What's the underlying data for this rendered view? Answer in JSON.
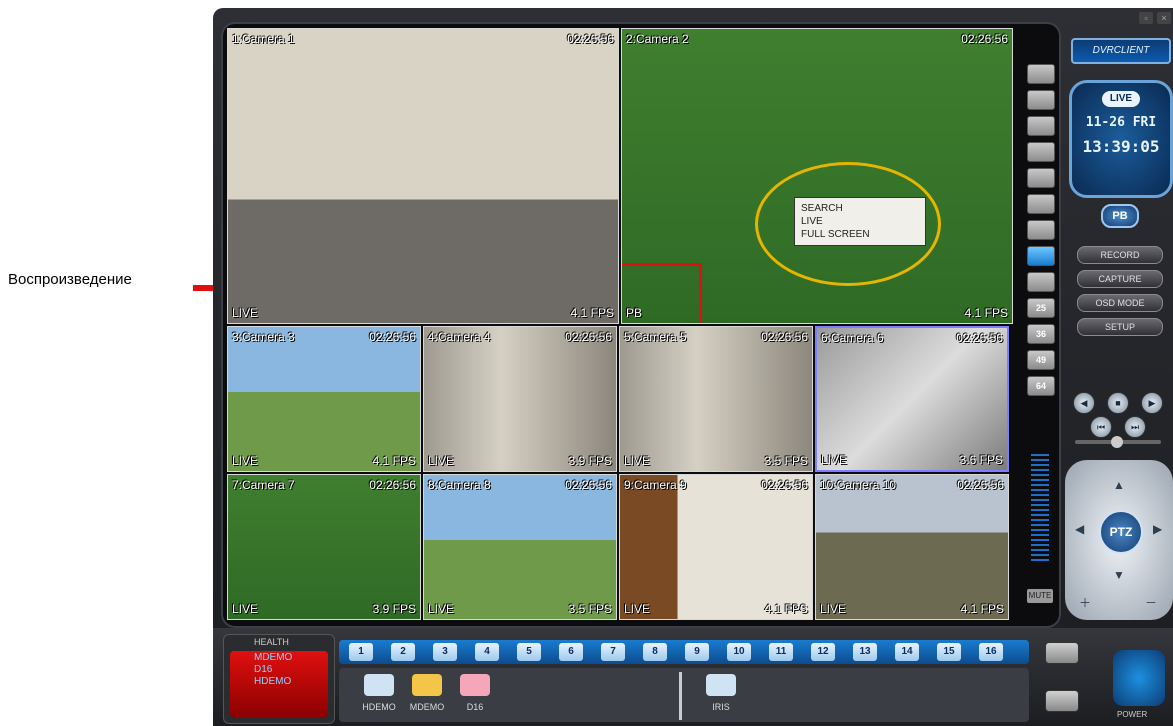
{
  "annotation": {
    "label": "Воспроизведение",
    "arrow_color": "#e01010"
  },
  "app": {
    "title": "DVRCLIENT",
    "status": "LIVE",
    "date": "11-26 FRI",
    "time": "13:39:05",
    "pb_label": "PB",
    "buttons": [
      "RECORD",
      "CAPTURE",
      "OSD MODE",
      "SETUP"
    ],
    "ptz_label": "PTZ",
    "mute_label": "MUTE",
    "power_label": "POWER"
  },
  "tiles": [
    {
      "name": "1:Camera 1",
      "time": "02:26:56",
      "mode": "LIVE",
      "fps": "4.1 FPS",
      "scene": "office"
    },
    {
      "name": "2:Camera 2",
      "time": "02:26:56",
      "mode": "PB",
      "fps": "4.1 FPS",
      "scene": "football"
    },
    {
      "name": "3:Camera 3",
      "time": "02:26:56",
      "mode": "LIVE",
      "fps": "4.1 FPS",
      "scene": "cartoon"
    },
    {
      "name": "4:Camera 4",
      "time": "02:26:56",
      "mode": "LIVE",
      "fps": "3.9 FPS",
      "scene": "hall"
    },
    {
      "name": "5:Camera 5",
      "time": "02:26:56",
      "mode": "LIVE",
      "fps": "3.5 FPS",
      "scene": "hall"
    },
    {
      "name": "6:Camera 6",
      "time": "02:26:56",
      "mode": "LIVE",
      "fps": "3.6 FPS",
      "scene": "grey"
    },
    {
      "name": "7:Camera 7",
      "time": "02:26:56",
      "mode": "LIVE",
      "fps": "3.9 FPS",
      "scene": "football"
    },
    {
      "name": "8:Camera 8",
      "time": "02:26:56",
      "mode": "LIVE",
      "fps": "3.5 FPS",
      "scene": "cartoon"
    },
    {
      "name": "9:Camera 9",
      "time": "02:26:56",
      "mode": "LIVE",
      "fps": "4.1 FPS",
      "scene": "door"
    },
    {
      "name": "10:Camera 10",
      "time": "02:26:56",
      "mode": "LIVE",
      "fps": "4.1 FPS",
      "scene": "outdoor"
    }
  ],
  "context_menu": [
    "SEARCH",
    "LIVE",
    "FULL SCREEN"
  ],
  "layout_buttons": [
    "",
    "",
    "",
    "",
    "",
    "",
    "",
    "",
    "",
    "25",
    "36",
    "49",
    "64"
  ],
  "health": {
    "title": "HEALTH",
    "lines": [
      "MDEMO",
      "D16",
      "HDEMO"
    ]
  },
  "channels": [
    "1",
    "2",
    "3",
    "4",
    "5",
    "6",
    "7",
    "8",
    "9",
    "10",
    "11",
    "12",
    "13",
    "14",
    "15",
    "16"
  ],
  "devices": [
    {
      "label": "HDEMO",
      "color": "#cfe3f5"
    },
    {
      "label": "MDEMO",
      "color": "#f3c64a"
    },
    {
      "label": "D16",
      "color": "#f5a6b8"
    },
    {
      "label": "IRIS",
      "color": "#cfe3f5"
    }
  ]
}
